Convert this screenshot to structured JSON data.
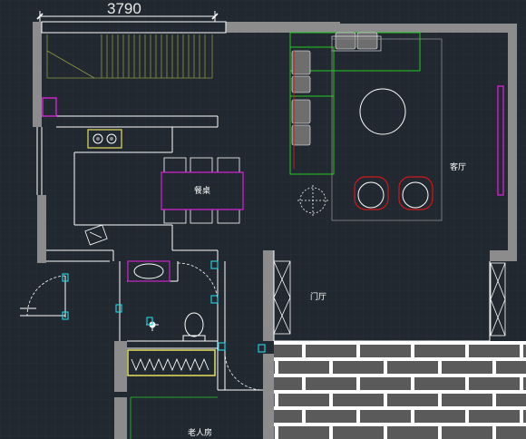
{
  "drawing": {
    "dimension_label": "3790",
    "rooms": {
      "living_room": "客厅",
      "dining_table": "餐桌",
      "foyer": "门厅",
      "elder_bedroom": "老人房"
    },
    "colors": {
      "background": "#212830",
      "grid": "#2b3440",
      "wall": "#8c8c8c",
      "line_white": "#ffffff",
      "green": "#22cc22",
      "magenta": "#cc22cc",
      "red": "#d01818",
      "yellow": "#e6e060",
      "cyan": "#22ccd8",
      "olive": "#8a9a40",
      "gray_furniture": "#6e6e6e",
      "brick_fill": "#5a5a5a"
    }
  }
}
